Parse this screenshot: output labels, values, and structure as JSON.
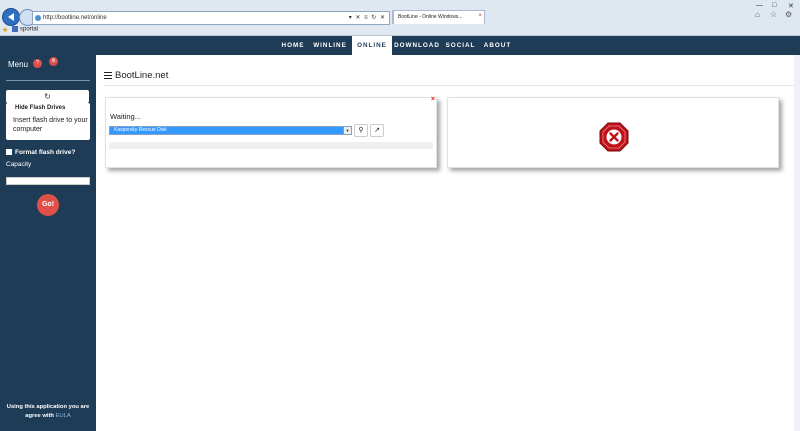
{
  "browser": {
    "address": "http://bootline.net/online",
    "address_tools": "▾ ✕ ≡ ↻ ✕",
    "tabs": [
      "",
      "",
      "",
      "",
      "",
      "",
      "",
      "BootLine - Online Windows..."
    ],
    "bookmark": "sportal"
  },
  "topnav": {
    "items": [
      {
        "label": "HOME"
      },
      {
        "label": "WINLINE"
      },
      {
        "label": "ONLINE"
      },
      {
        "label": "DOWNLOAD"
      },
      {
        "label": "SOCIAL"
      },
      {
        "label": "ABOUT"
      }
    ],
    "active": "ONLINE"
  },
  "sidebar": {
    "menu_label": "Menu",
    "refresh_icon": "refresh-icon",
    "hide_label": "Hide Flash Drives",
    "insert_text": "Insert flash drive to your computer",
    "format_label": "Format flash drive?",
    "capacity_label": "Capacity",
    "capacity_value": "",
    "go_label": "Go!",
    "eula_text": "Using this application you are agree with",
    "eula_link": "EULA"
  },
  "main": {
    "page_title": "BootLine.net",
    "left_card": {
      "status": "Waiting...",
      "selected_option": "Kaspersky Rescue Disk",
      "close_symbol": "×"
    },
    "right_card": {
      "icon": "error-stop-icon"
    }
  },
  "colors": {
    "nav_bg": "#1f3c56",
    "accent_red": "#e0504a",
    "select_blue": "#3399ff"
  }
}
